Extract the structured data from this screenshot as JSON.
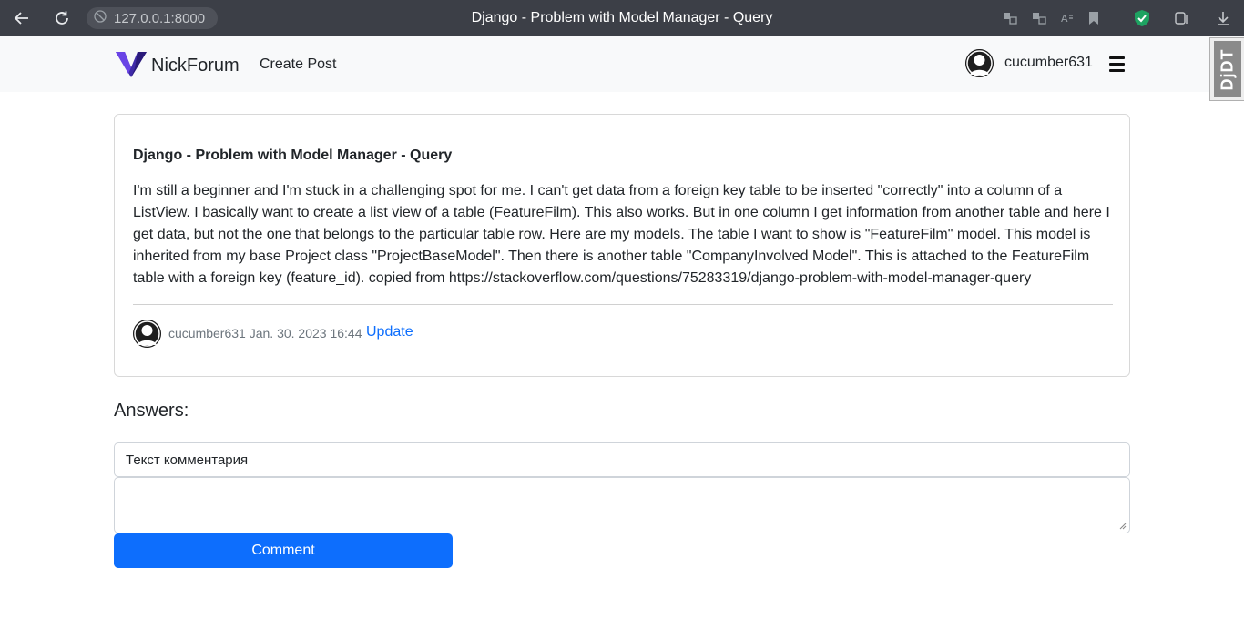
{
  "browser": {
    "url": "127.0.0.1:8000",
    "tab_title": "Django - Problem with Model Manager - Query"
  },
  "navbar": {
    "brand": "NickForum",
    "create_post": "Create Post",
    "username": "cucumber631",
    "debug_toolbar_label": "DjDT"
  },
  "post": {
    "title": "Django - Problem with Model Manager - Query",
    "body": "I'm still a beginner and I'm stuck in a challenging spot for me. I can't get data from a foreign key table to be inserted \"correctly\" into a column of a ListView. I basically want to create a list view of a table (FeatureFilm). This also works. But in one column I get information from another table and here I get data, but not the one that belongs to the particular table row. Here are my models. The table I want to show is \"FeatureFilm\" model. This model is inherited from my base Project class \"ProjectBaseModel\". Then there is another table \"CompanyInvolved Model\". This is attached to the FeatureFilm table with a foreign key (feature_id). copied from https://stackoverflow.com/questions/75283319/django-problem-with-model-manager-query",
    "author_date": "cucumber631 Jan. 30. 2023 16:44",
    "update_label": "Update"
  },
  "answers": {
    "heading": "Answers:",
    "comment_input_value": "Текст комментария",
    "comment_textarea_value": "",
    "comment_button": "Comment"
  },
  "colors": {
    "primary": "#0d6efd",
    "navbar_bg": "#f8f9fa",
    "chrome_bg": "#3c3f47",
    "shield_green": "#1ea362"
  }
}
